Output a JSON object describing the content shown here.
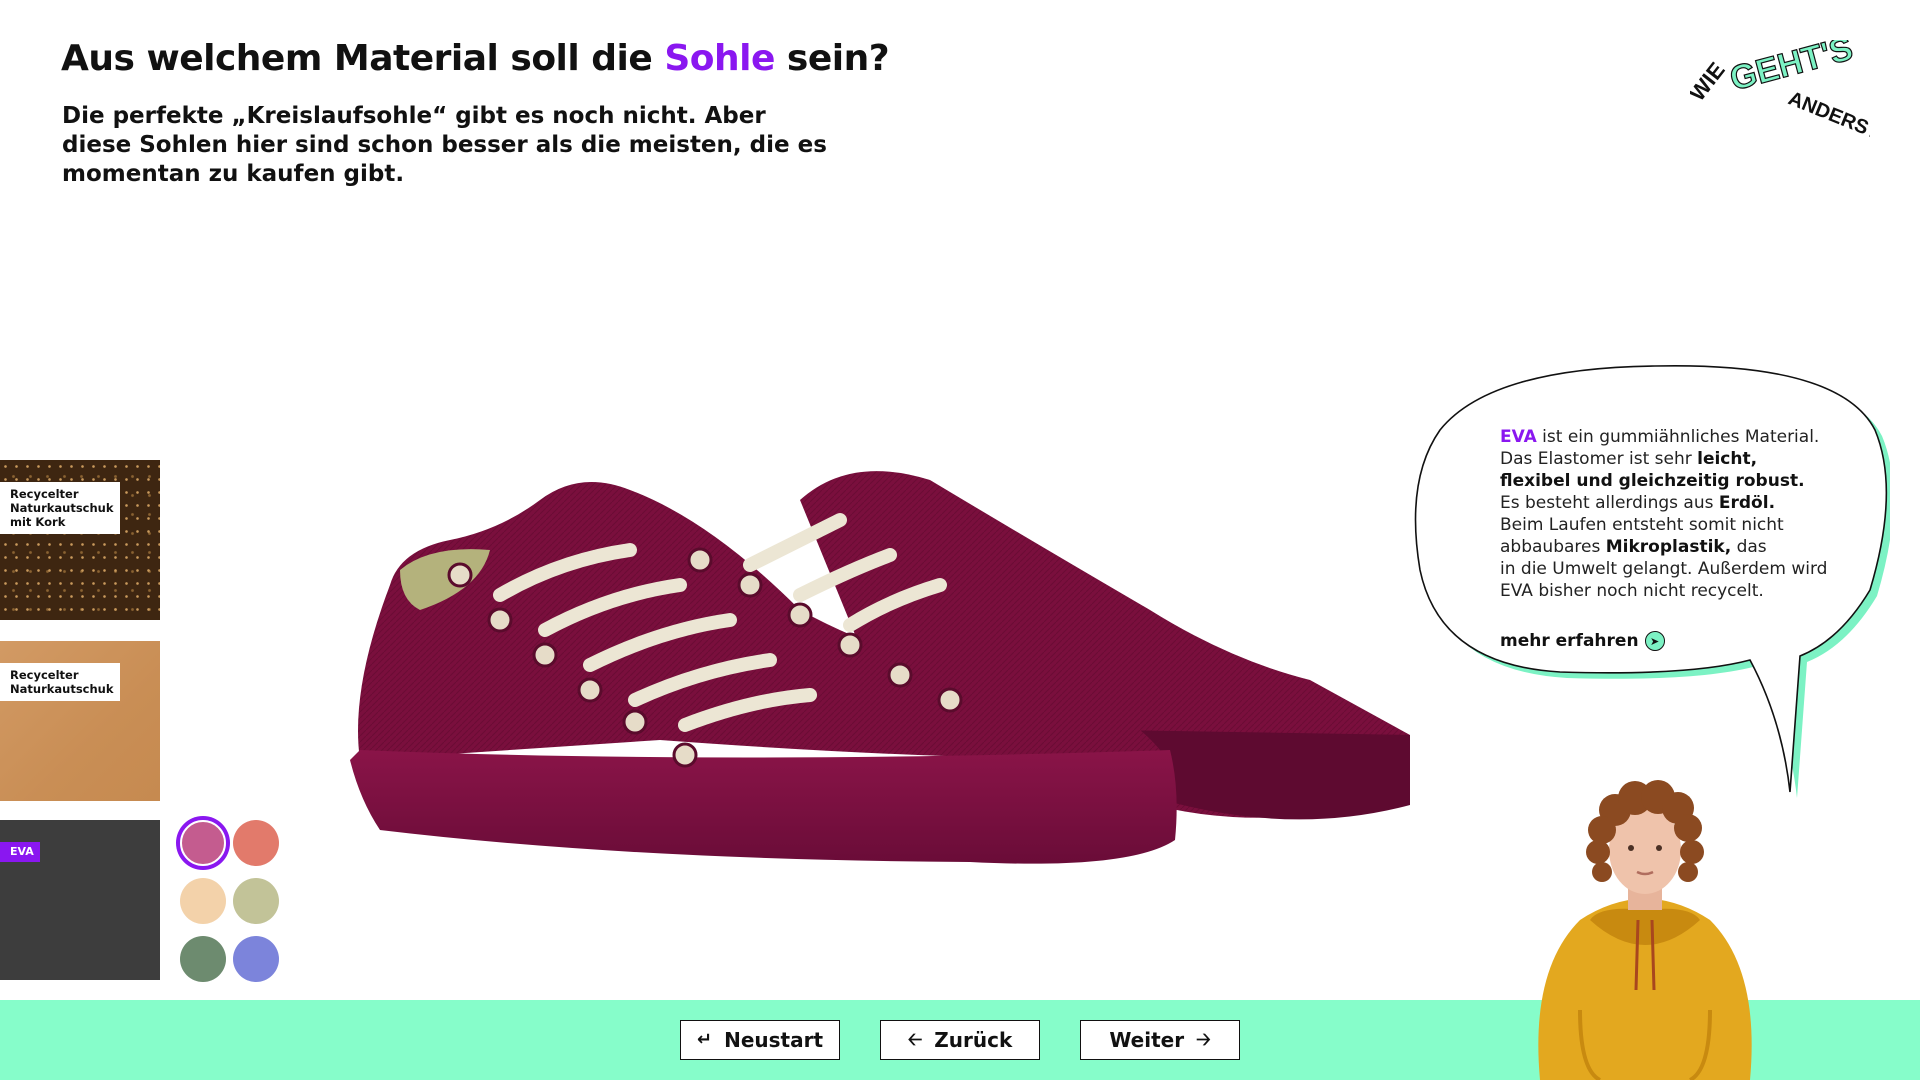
{
  "header": {
    "title_prefix": "Aus welchem Material soll die ",
    "title_accent": "Sohle",
    "title_suffix": " sein?",
    "subtitle": "Die perfekte „Kreislaufsohle“ gibt es noch nicht. Aber diese Sohlen hier sind schon besser als die meisten, die es momentan zu kaufen gibt."
  },
  "logo": {
    "line1": "WIE",
    "line2": "GEHT'S",
    "line3": "ANDERS?"
  },
  "materials": [
    {
      "label_lines": [
        "Recycelter",
        "Naturkautschuk",
        "mit Kork"
      ]
    },
    {
      "label_lines": [
        "Recycelter",
        "Naturkautschuk"
      ]
    },
    {
      "label": "EVA",
      "selected": true
    }
  ],
  "colors": [
    {
      "hex": "#c45c8f",
      "selected": true
    },
    {
      "hex": "#e27a6b"
    },
    {
      "hex": "#f3d2aa"
    },
    {
      "hex": "#c2c398"
    },
    {
      "hex": "#6d8b6f"
    },
    {
      "hex": "#7c84db"
    }
  ],
  "info": {
    "material_name": "EVA",
    "l1": " ist ein gummiähnliches Material.",
    "l2a": "Das Elastomer ist sehr ",
    "l2b": "leicht,",
    "l3": "flexibel und gleichzeitig robust.",
    "l4a": "Es besteht allerdings aus ",
    "l4b": "Erdöl.",
    "l5": "Beim Laufen entsteht somit nicht",
    "l6a": "abbaubares ",
    "l6b": "Mikroplastik,",
    "l6c": " das",
    "l7": "in die Umwelt gelangt. Außerdem wird",
    "l8": "EVA bisher noch nicht recycelt.",
    "more": "mehr erfahren"
  },
  "nav": {
    "restart": "Neustart",
    "back": "Zurück",
    "next": "Weiter"
  },
  "theme": {
    "accent": "#8a17f0",
    "mint": "#86fdca",
    "shoe_upper": "#7a0f3d",
    "sole": "#7a1040"
  }
}
